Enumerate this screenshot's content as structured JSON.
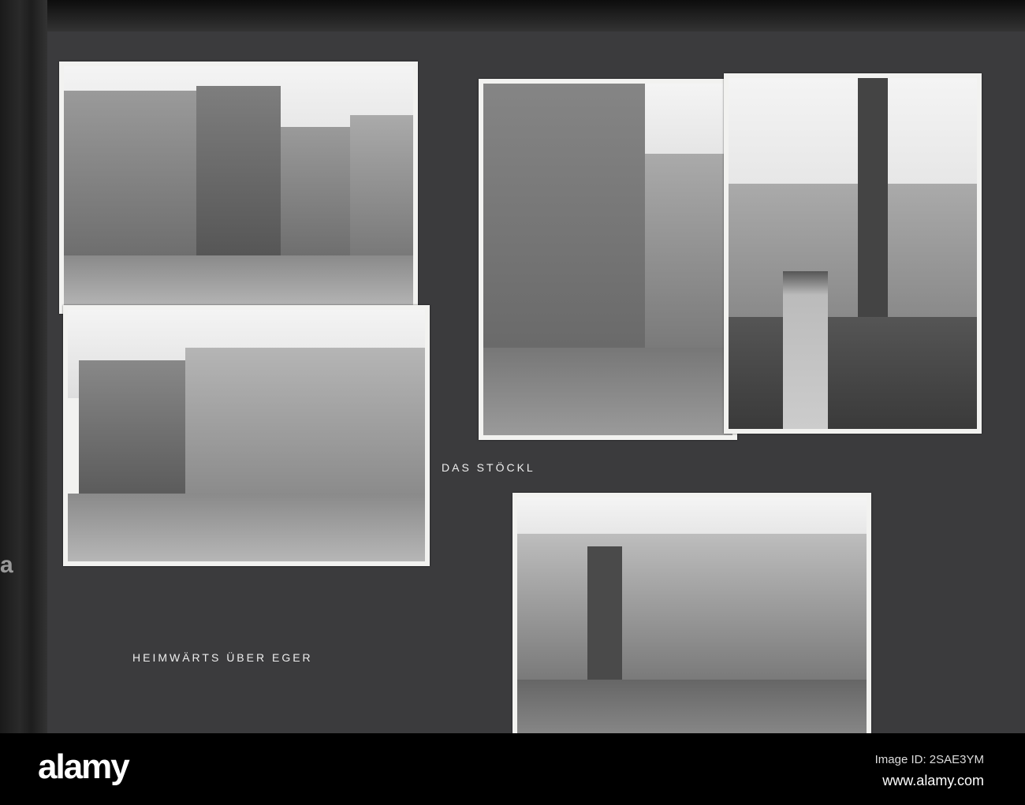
{
  "captions": {
    "das_stoeckl": "DAS STÖCKL",
    "heimwaerts": "HEIMWÄRTS ÜBER EGER"
  },
  "watermark": {
    "logo": "alamy",
    "image_id": "Image ID: 2SAE3YM",
    "site": "www.alamy.com"
  }
}
